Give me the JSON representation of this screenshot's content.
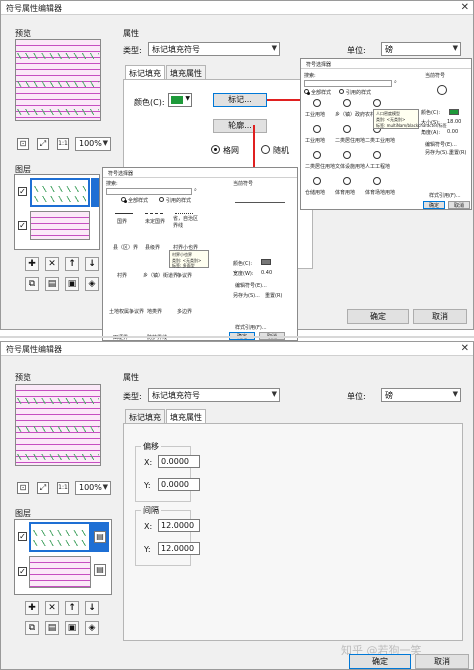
{
  "top_window": {
    "title": "符号属性编辑器",
    "preview_label": "预览",
    "zoom_value": "100%",
    "layers_label": "图层",
    "properties_label": "属性",
    "type_label": "类型:",
    "type_value": "标记填充符号",
    "unit_label": "单位:",
    "unit_value": "磅",
    "tabs": [
      "标记填充",
      "填充属性"
    ],
    "color_label": "颜色(C):",
    "color_hex": "#1e9a3a",
    "marker_button": "标记...",
    "outline_button": "轮廓...",
    "radio_grid": "格网",
    "radio_random": "随机",
    "ok_button": "确定",
    "cancel_button": "取消"
  },
  "popup_large": {
    "title": "符号选择器",
    "current_symbol_label": "当前符号",
    "search_label": "搜索:",
    "search_option": "全部样式",
    "reference_option": "引用的样式",
    "items": [
      "工业用地",
      "乡（镇）政府",
      "农村居民",
      "工业用地",
      "二类居住用地",
      "二类工业用地",
      "二类居住用地",
      "文体设施用地",
      "人工工程地",
      "仓储用地",
      "体育用地",
      "体育场地用地"
    ],
    "tooltip_title": "人口密度模型",
    "tooltip_body": "类别: <无类别>",
    "tooltip_tags": "标签: multiNam/blackcharacter/标签",
    "color_label": "颜色(C):",
    "size_label": "大小(S):",
    "size_value": "18.00",
    "angle_label": "角度(A):",
    "angle_value": "0.00",
    "edit_button": "编辑符号(E)...",
    "save_button": "另存为(S)...",
    "reset_button": "重置(R)",
    "style_button": "样式引用(F)...",
    "ok_button": "确定",
    "cancel_button": "取消"
  },
  "popup_small": {
    "title": "符号选择器",
    "current_symbol_label": "当前符号",
    "search_label": "搜索:",
    "search_option": "全部样式",
    "reference_option": "引用的样式",
    "items": [
      "国界",
      "未定国界",
      "省，自治区界线",
      "县（区）界",
      "县级界",
      "村界小也界",
      "村界",
      "乡（镇）街道界",
      "争议界",
      "土地权属争议界",
      "地类界",
      "多边界",
      "田埂界",
      "防护界线"
    ],
    "tooltip_title": "村界小也界",
    "tooltip_body": "类别: <无类别>",
    "tooltip_tags": "标签: 多面型",
    "color_label": "颜色(C):",
    "width_label": "宽度(W):",
    "width_value": "0.40",
    "edit_button": "编辑符号(E)...",
    "save_button": "另存为(S)...",
    "reset_button": "重置(R)",
    "style_button": "样式引用(F)...",
    "ok_button": "确定",
    "cancel_button": "取消"
  },
  "bottom_window": {
    "title": "符号属性编辑器",
    "preview_label": "预览",
    "zoom_value": "100%",
    "layers_label": "图层",
    "properties_label": "属性",
    "type_label": "类型:",
    "type_value": "标记填充符号",
    "unit_label": "单位:",
    "unit_value": "磅",
    "tabs": [
      "标记填充",
      "填充属性"
    ],
    "offset_group": "偏移",
    "x_label": "X:",
    "y_label": "Y:",
    "offset_x": "0.0000",
    "offset_y": "0.0000",
    "spacing_group": "间隔",
    "spacing_x": "12.0000",
    "spacing_y": "12.0000",
    "ok_button": "确定",
    "cancel_button": "取消",
    "watermark": "知乎 @若狗一笑"
  }
}
